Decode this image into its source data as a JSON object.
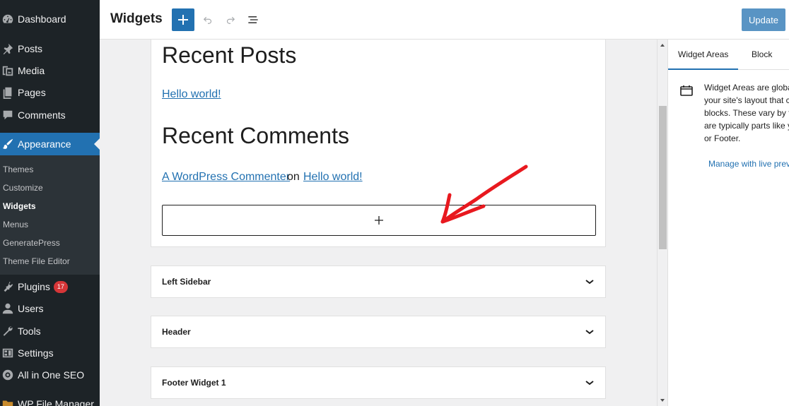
{
  "admin_menu": {
    "items": [
      {
        "label": "Dashboard",
        "icon": "dashboard-icon"
      },
      {
        "label": "Posts",
        "icon": "pin-icon"
      },
      {
        "label": "Media",
        "icon": "media-icon"
      },
      {
        "label": "Pages",
        "icon": "pages-icon"
      },
      {
        "label": "Comments",
        "icon": "comment-icon"
      },
      {
        "label": "Appearance",
        "icon": "paintbrush-icon"
      },
      {
        "label": "Plugins",
        "icon": "plugin-icon",
        "badge": "17"
      },
      {
        "label": "Users",
        "icon": "user-icon"
      },
      {
        "label": "Tools",
        "icon": "wrench-icon"
      },
      {
        "label": "Settings",
        "icon": "settings-icon"
      },
      {
        "label": "All in One SEO",
        "icon": "seo-icon"
      },
      {
        "label": "WP File Manager",
        "icon": "file-manager-icon"
      }
    ],
    "submenu": [
      "Themes",
      "Customize",
      "Widgets",
      "Menus",
      "GeneratePress",
      "Theme File Editor"
    ],
    "active_item": "Appearance",
    "current_submenu": "Widgets"
  },
  "header": {
    "title": "Widgets",
    "update_label": "Update"
  },
  "canvas": {
    "open_area": {
      "heading_posts": "Recent Posts",
      "post_link": "Hello world!",
      "heading_comments": "Recent Comments",
      "comment_author": "A WordPress Commenter",
      "comment_on": "on",
      "comment_post": "Hello world!"
    },
    "collapsed_areas": [
      "Left Sidebar",
      "Header",
      "Footer Widget 1"
    ]
  },
  "settings_sidebar": {
    "tabs": [
      "Widget Areas",
      "Block"
    ],
    "active_tab": "Widget Areas",
    "description": "Widget Areas are global parts in your site's layout that can accept blocks. These vary by theme, but are typically parts like your Sidebar or Footer.",
    "manage_link": "Manage with live preview"
  },
  "colors": {
    "accent": "#2271b1",
    "admin_bg": "#1d2327",
    "badge": "#d63638",
    "annotation_arrow": "#e8191f"
  }
}
